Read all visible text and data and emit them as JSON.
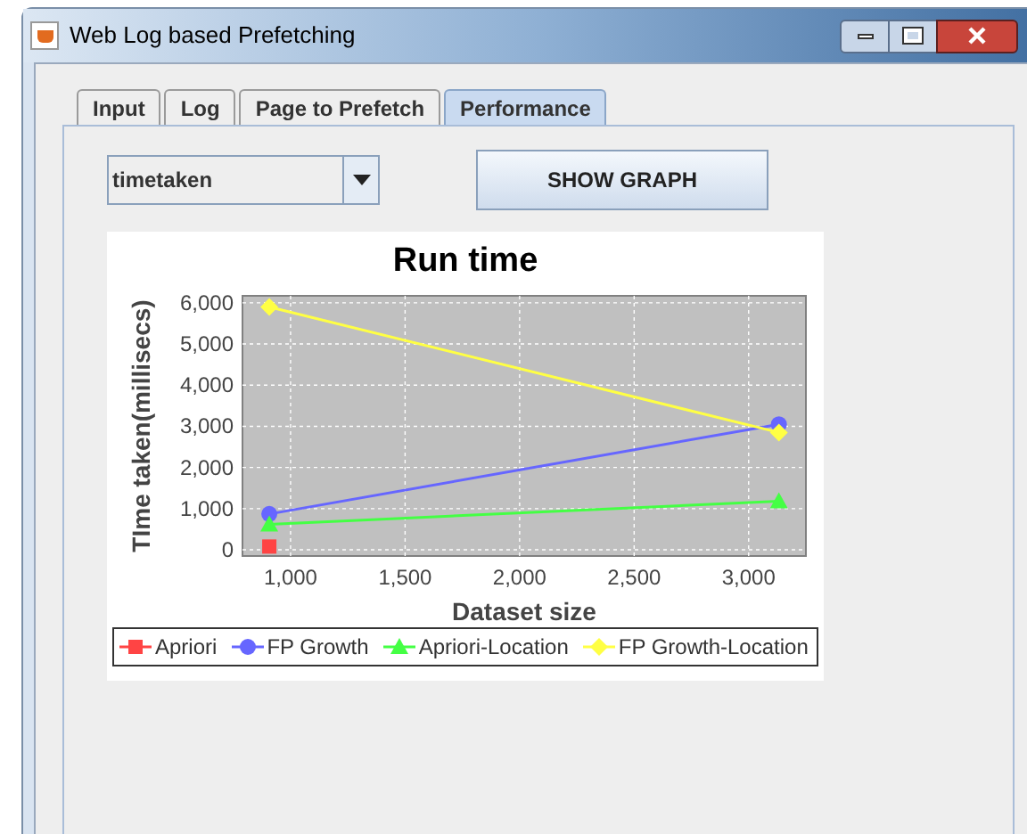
{
  "window": {
    "title": "Web Log based Prefetching"
  },
  "tabs": [
    {
      "label": "Input",
      "selected": false
    },
    {
      "label": "Log",
      "selected": false
    },
    {
      "label": "Page to Prefetch",
      "selected": false
    },
    {
      "label": "Performance",
      "selected": true
    }
  ],
  "combo": {
    "value": "timetaken"
  },
  "button": {
    "label": "SHOW GRAPH"
  },
  "chart_data": {
    "type": "line",
    "grid": true,
    "title": "Run time",
    "xlabel": "Dataset size",
    "ylabel": "TIme taken(millisecs)",
    "x": [
      907,
      3132
    ],
    "xlim": [
      790,
      3250
    ],
    "ylim": [
      -150,
      6170
    ],
    "xticks": [
      {
        "value": 1000,
        "label": "1,000"
      },
      {
        "value": 1500,
        "label": "1,500"
      },
      {
        "value": 2000,
        "label": "2,000"
      },
      {
        "value": 2500,
        "label": "2,500"
      },
      {
        "value": 3000,
        "label": "3,000"
      }
    ],
    "yticks": [
      {
        "value": 0,
        "label": "0"
      },
      {
        "value": 1000,
        "label": "1,000"
      },
      {
        "value": 2000,
        "label": "2,000"
      },
      {
        "value": 3000,
        "label": "3,000"
      },
      {
        "value": 4000,
        "label": "4,000"
      },
      {
        "value": 5000,
        "label": "5,000"
      },
      {
        "value": 6000,
        "label": "6,000"
      }
    ],
    "series": [
      {
        "name": "Apriori",
        "color": "#ff4444",
        "marker": "square",
        "values": [
          80,
          null
        ]
      },
      {
        "name": "FP Growth",
        "color": "#6666ff",
        "marker": "circle",
        "values": [
          870,
          3050
        ]
      },
      {
        "name": "Apriori-Location",
        "color": "#44ff44",
        "marker": "triangle",
        "values": [
          620,
          1180
        ]
      },
      {
        "name": "FP Growth-Location",
        "color": "#ffff44",
        "marker": "diamond",
        "values": [
          5900,
          2850
        ]
      }
    ]
  }
}
